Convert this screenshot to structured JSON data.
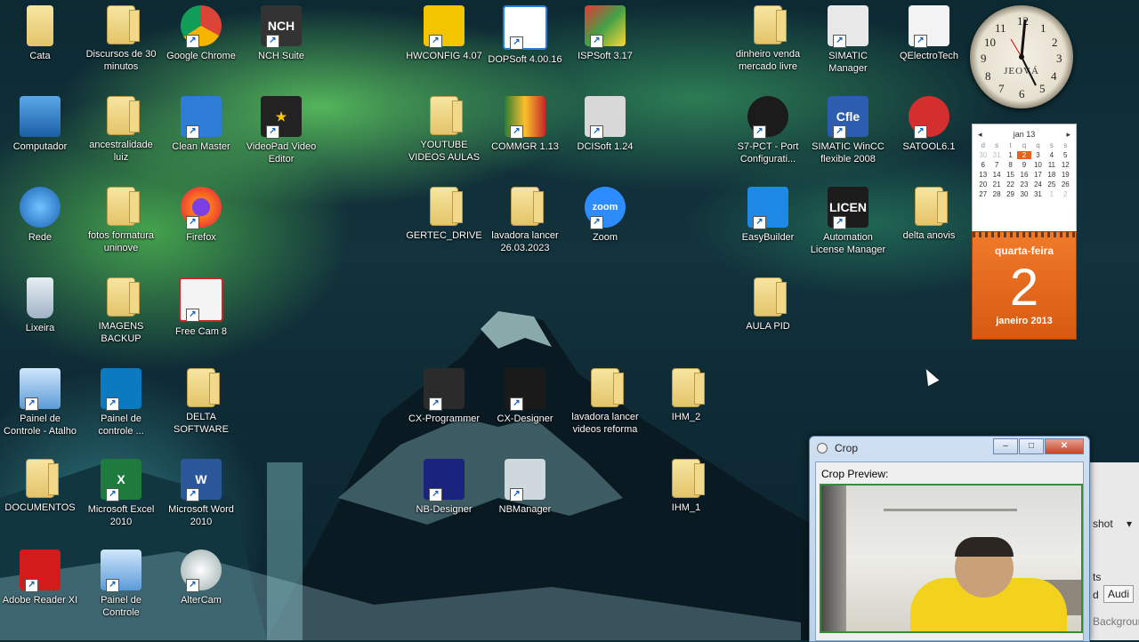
{
  "desktop": {
    "icons": [
      {
        "label": "Cata",
        "icon": "user-folder-icon",
        "shortcut": false
      },
      {
        "label": "Discursos de 30\nminutos",
        "icon": "folder-icon",
        "shortcut": false
      },
      {
        "label": "Google Chrome",
        "icon": "chrome-icon",
        "shortcut": true
      },
      {
        "label": "NCH Suite",
        "icon": "nch-suite-icon",
        "shortcut": true
      },
      {
        "label": "HWCONFIG 4.07",
        "icon": "hwconfig-icon",
        "shortcut": true
      },
      {
        "label": "DOPSoft 4.00.16",
        "icon": "dopsoft-icon",
        "shortcut": true
      },
      {
        "label": "ISPSoft 3.17",
        "icon": "ispsoft-icon",
        "shortcut": true
      },
      {
        "label": "dinheiro venda\nmercado livre",
        "icon": "folder-icon",
        "shortcut": false
      },
      {
        "label": "SIMATIC\nManager",
        "icon": "simatic-manager-icon",
        "shortcut": true
      },
      {
        "label": "QElectroTech",
        "icon": "qelectrotech-icon",
        "shortcut": true
      },
      {
        "label": "Computador",
        "icon": "computer-icon",
        "shortcut": false
      },
      {
        "label": "ancestralidade\nluiz",
        "icon": "folder-icon",
        "shortcut": false
      },
      {
        "label": "Clean Master",
        "icon": "clean-master-icon",
        "shortcut": true
      },
      {
        "label": "VideoPad Video\nEditor",
        "icon": "videopad-icon",
        "shortcut": true
      },
      {
        "label": "YOUTUBE\nVIDEOS AULAS",
        "icon": "folder-icon",
        "shortcut": false
      },
      {
        "label": "COMMGR 1.13",
        "icon": "commgr-icon",
        "shortcut": true
      },
      {
        "label": "DCISoft 1.24",
        "icon": "dcisoft-icon",
        "shortcut": true
      },
      {
        "label": "S7-PCT - Port\nConfigurati...",
        "icon": "s7-pct-icon",
        "shortcut": true
      },
      {
        "label": "SIMATIC WinCC\nflexible 2008",
        "icon": "wincc-icon",
        "shortcut": true
      },
      {
        "label": "SATOOL6.1",
        "icon": "satool-icon",
        "shortcut": true
      },
      {
        "label": "Rede",
        "icon": "network-icon",
        "shortcut": false
      },
      {
        "label": "fotos formatura\nuninove",
        "icon": "folder-icon",
        "shortcut": false
      },
      {
        "label": "Firefox",
        "icon": "firefox-icon",
        "shortcut": true
      },
      {
        "label": "GERTEC_DRIVE",
        "icon": "folder-icon",
        "shortcut": false
      },
      {
        "label": "lavadora lancer\n26.03.2023",
        "icon": "folder-icon",
        "shortcut": false
      },
      {
        "label": "Zoom",
        "icon": "zoom-icon",
        "shortcut": true
      },
      {
        "label": "EasyBuilder",
        "icon": "easybuilder-icon",
        "shortcut": true
      },
      {
        "label": "Automation\nLicense Manager",
        "icon": "license-manager-icon",
        "shortcut": true
      },
      {
        "label": "delta anovis",
        "icon": "folder-icon",
        "shortcut": false
      },
      {
        "label": "Lixeira",
        "icon": "recycle-bin-icon",
        "shortcut": false
      },
      {
        "label": "IMAGENS\nBACKUP",
        "icon": "folder-icon",
        "shortcut": false
      },
      {
        "label": "Free Cam 8",
        "icon": "free-cam-icon",
        "shortcut": true
      },
      {
        "label": "AULA PID",
        "icon": "folder-icon",
        "shortcut": false
      },
      {
        "label": "Painel de\nControle - Atalho",
        "icon": "control-panel-icon",
        "shortcut": true
      },
      {
        "label": "Painel de\ncontrole ...",
        "icon": "intel-control-panel-icon",
        "shortcut": true
      },
      {
        "label": "DELTA\nSOFTWARE",
        "icon": "folder-icon",
        "shortcut": false
      },
      {
        "label": "CX-Programmer",
        "icon": "cx-programmer-icon",
        "shortcut": true
      },
      {
        "label": "CX-Designer",
        "icon": "cx-designer-icon",
        "shortcut": true
      },
      {
        "label": "lavadora lancer\nvideos reforma",
        "icon": "folder-icon",
        "shortcut": false
      },
      {
        "label": "IHM_2",
        "icon": "folder-icon",
        "shortcut": false
      },
      {
        "label": "DOCUMENTOS",
        "icon": "folder-icon",
        "shortcut": false
      },
      {
        "label": "Microsoft Excel\n2010",
        "icon": "excel-icon",
        "shortcut": true
      },
      {
        "label": "Microsoft Word\n2010",
        "icon": "word-icon",
        "shortcut": true
      },
      {
        "label": "NB-Designer",
        "icon": "nb-designer-icon",
        "shortcut": true
      },
      {
        "label": "NBManager",
        "icon": "nbmanager-icon",
        "shortcut": true
      },
      {
        "label": "IHM_1",
        "icon": "folder-icon",
        "shortcut": false
      },
      {
        "label": "Adobe Reader XI",
        "icon": "adobe-reader-icon",
        "shortcut": true
      },
      {
        "label": "Painel de\nControle",
        "icon": "control-panel-icon",
        "shortcut": true
      },
      {
        "label": "AlterCam",
        "icon": "altercam-icon",
        "shortcut": true
      }
    ]
  },
  "clock": {
    "brand": "JEOVÁ",
    "numerals": [
      "12",
      "1",
      "2",
      "3",
      "4",
      "5",
      "6",
      "7",
      "8",
      "9",
      "10",
      "11"
    ]
  },
  "calendar": {
    "month": "jan 13",
    "weekdays": [
      "d",
      "s",
      "t",
      "q",
      "q",
      "s",
      "s"
    ],
    "days": [
      [
        "30",
        "31",
        "1",
        "2",
        "3",
        "4",
        "5"
      ],
      [
        "6",
        "7",
        "8",
        "9",
        "10",
        "11",
        "12"
      ],
      [
        "13",
        "14",
        "15",
        "16",
        "17",
        "18",
        "19"
      ],
      [
        "20",
        "21",
        "22",
        "23",
        "24",
        "25",
        "26"
      ],
      [
        "27",
        "28",
        "29",
        "30",
        "31",
        "1",
        "2"
      ]
    ],
    "page_weekday": "quarta-feira",
    "page_day": "2",
    "page_month_year": "janeiro 2013"
  },
  "crop_window": {
    "title": "Crop",
    "preview_label": "Crop Preview:",
    "buttons": {
      "minimize": "–",
      "maximize": "□",
      "close": "✕"
    }
  },
  "background_window": {
    "text_shot": "shot",
    "text_ts": "ts",
    "text_d": "d",
    "text_audio": "Audi",
    "text_background": "Backgroun"
  },
  "colors": {
    "calendar_accent": "#e8621c",
    "preview_border": "#3a8a3a"
  }
}
